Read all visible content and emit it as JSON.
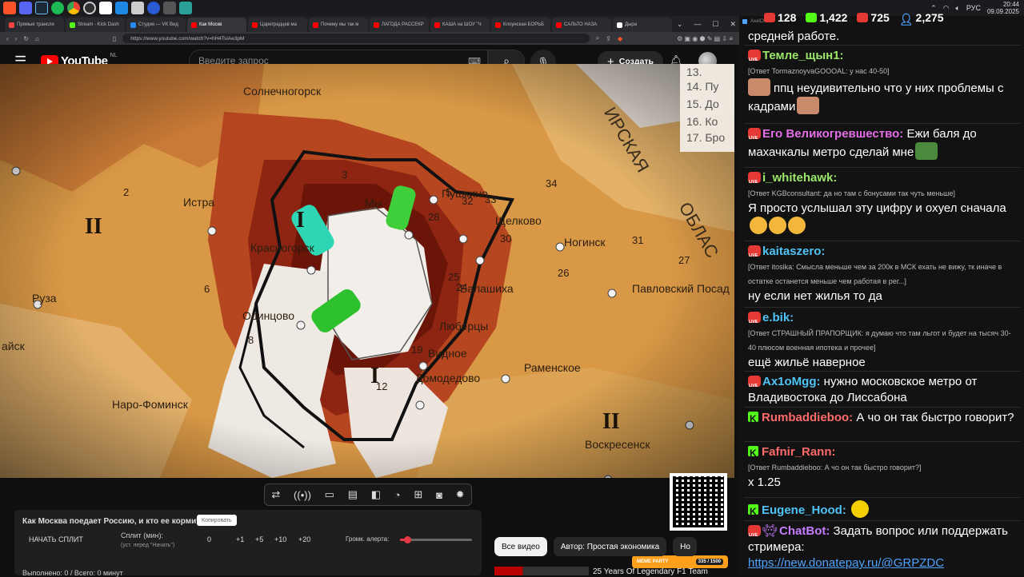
{
  "taskbar": {
    "icons": [
      "brave-icon",
      "discord-icon",
      "steam-icon",
      "spotify-icon",
      "chrome-icon",
      "obs-icon",
      "epic-icon",
      "app-icon",
      "telegram-icon",
      "skype-icon",
      "app-icon",
      "app-icon"
    ],
    "lang": "РУС",
    "time": "20:44",
    "date": "09.09.2025"
  },
  "browser": {
    "tabs": [
      {
        "label": "Прямые трансля",
        "color": "#ff4444"
      },
      {
        "label": "Stream - Kick Dash",
        "color": "#53fc18"
      },
      {
        "label": "Студия — VK Вид",
        "color": "#2787f5"
      },
      {
        "label": "Как Москв",
        "color": "#ff0000",
        "active": true
      },
      {
        "label": "Цареградцев ма",
        "color": "#ff0000"
      },
      {
        "label": "Почему мы так м",
        "color": "#ff0000"
      },
      {
        "label": "ЛАГОДА РАССЕКР",
        "color": "#ff0000"
      },
      {
        "label": "КАША на ШОУ \"Ч",
        "color": "#ff0000"
      },
      {
        "label": "Клоунская БОРЬБ",
        "color": "#ff0000"
      },
      {
        "label": "САЛЬТО НАЗА",
        "color": "#ff0000"
      },
      {
        "label": "Дыра",
        "color": "#ffffff"
      }
    ],
    "url": "https://www.youtube.com/watch?v=hH4TsiAe3pM"
  },
  "youtube": {
    "wordmark": "YouTube",
    "region": "NL",
    "search_placeholder": "Введите запрос",
    "create_label": "Создать"
  },
  "video": {
    "labels": [
      {
        "text": "Солнечногорск"
      },
      {
        "text": "Истра"
      },
      {
        "text": "Красногорск"
      },
      {
        "text": "Одинцово"
      },
      {
        "text": "Руза"
      },
      {
        "text": "Наро-Фоминск"
      },
      {
        "text": "Домодедово"
      },
      {
        "text": "Видное"
      },
      {
        "text": "Люберцы"
      },
      {
        "text": "Балашиха"
      },
      {
        "text": "Щелково"
      },
      {
        "text": "Пушкино"
      },
      {
        "text": "Мы"
      },
      {
        "text": "Ногинск"
      },
      {
        "text": "Павловский Посад"
      },
      {
        "text": "Раменское"
      },
      {
        "text": "Воскресенск"
      },
      {
        "text": "ОБЛАС"
      },
      {
        "text": "ИРСКАЯ"
      },
      {
        "text": "айск"
      }
    ],
    "numbers": [
      "2",
      "3",
      "5",
      "6",
      "8",
      "12",
      "19",
      "24",
      "25",
      "26",
      "27",
      "28",
      "30",
      "31",
      "32",
      "33",
      "34"
    ],
    "legend": [
      "13.",
      "14. Пу",
      "15. До",
      "16. Ко",
      "17. Бро"
    ],
    "roman": [
      "II",
      "I",
      "I",
      "II"
    ]
  },
  "player_tools": [
    "shuffle-icon",
    "broadcast-icon",
    "screen-icon",
    "clapper-icon",
    "frame-icon",
    "timer-icon",
    "add-scene-icon",
    "camera-icon",
    "gear-icon"
  ],
  "split": {
    "title": "Как Москва поедает Россию, и кто ее кормит",
    "copy_label": "Копировать",
    "start_label": "НАЧАТЬ СПЛИТ",
    "min_label": "Сплит (мин):",
    "min_sub": "(уст. перед \"Начать\")",
    "value": "0",
    "increments": [
      "+1",
      "+5",
      "+10",
      "+20"
    ],
    "alert_label": "Громк. алерта:",
    "alert_volume": 0.1,
    "bottom": "Выполнено: 0 / Всего: 0 минут"
  },
  "chips": [
    "Все видео",
    "Автор: Простая экономика",
    "Но"
  ],
  "recommendation": {
    "title": "25 Years Of Legendary F1 Team"
  },
  "qr": {
    "caption": "MEME PARTY",
    "counter": "335 / 1500"
  },
  "chat": {
    "app_name": "AxelChat",
    "stats": [
      {
        "platform": "youtube",
        "value": "128",
        "color": "#e53935"
      },
      {
        "platform": "kick",
        "value": "1,422",
        "color": "#53fc18"
      },
      {
        "platform": "vk",
        "value": "725",
        "color": "#e53935"
      },
      {
        "platform": "total",
        "value": "2,275",
        "color": "#4fa3ff"
      }
    ],
    "messages": [
      {
        "user": "",
        "text": "средней работе.",
        "color": "#fff"
      },
      {
        "user": "Темле_щын1:",
        "color": "#9be86a",
        "reply": "[Ответ TormaznoyvaGOOOAL: у нас 40-50]",
        "text": "ппц неудивительно что у них проблемы с кадрами"
      },
      {
        "user": "Его Великогревшество:",
        "color": "#e36ee6",
        "text": "Ежи баля до махачкалы метро сделай мне"
      },
      {
        "user": "i_whitehawk:",
        "color": "#9be86a",
        "reply": "[Ответ KGBconsultant: да но там с бонусами так чуть меньше]",
        "text": "Я просто услышал эту цифру и охуел сначала"
      },
      {
        "user": "kaitaszero:",
        "color": "#4fc3f7",
        "reply": "[Ответ itosika: Смысла меньше чем за 200к в МСК ехать не вижу, тк иначе в остатке останется меньше чем работая в рег...]",
        "text": "ну если нет жилья то да"
      },
      {
        "user": "e.bik:",
        "color": "#4fc3f7",
        "reply": "[Ответ СТРАШНЫЙ ПРАПОРЩИК: я думаю что там льгот и будет на тысяч 30-40 плюсом военная ипотека и прочее]",
        "text": "ещё жильё наверное"
      },
      {
        "user": "Ax1oMgg:",
        "color": "#4fc3f7",
        "text": "нужно московское метро от Владивостока до Лиссабона"
      },
      {
        "user": "Rumbaddieboo:",
        "color": "#ff6b6b",
        "text": "А чо он так быстро говорит?"
      },
      {
        "user": "Fafnir_Rann:",
        "color": "#ff6b6b",
        "reply": "[Ответ Rumbaddieboo: А чо он так быстро говорит?]",
        "text": "x 1.25"
      },
      {
        "user": "Eugene_Hood:",
        "color": "#4fc3f7",
        "text": ""
      },
      {
        "user": "ChatBot:",
        "color": "#c77dff",
        "text": "Задать вопрос или поддержать стримера:",
        "link": "https://new.donatepay.ru/@GRPZDC"
      }
    ]
  }
}
